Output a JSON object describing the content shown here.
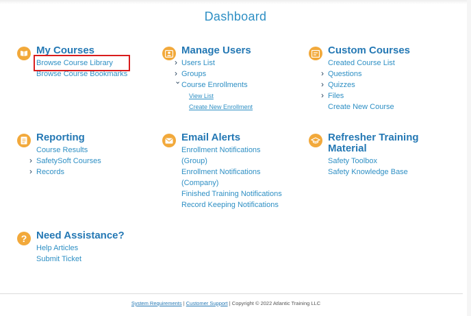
{
  "page": {
    "title": "Dashboard"
  },
  "sections": {
    "my_courses": {
      "title": "My Courses",
      "icon": "book-icon",
      "links": [
        "Browse Course Library",
        "Browse Course Bookmarks"
      ]
    },
    "manage_users": {
      "title": "Manage Users",
      "icon": "user-badge-icon",
      "links": [
        "Users List",
        "Groups",
        "Course Enrollments"
      ],
      "sub_links": [
        "View List",
        "Create New Enrollment"
      ]
    },
    "custom_courses": {
      "title": "Custom Courses",
      "icon": "edit-document-icon",
      "links": [
        "Created Course List",
        "Questions",
        "Quizzes",
        "Files",
        "Create New Course"
      ]
    },
    "reporting": {
      "title": "Reporting",
      "icon": "report-icon",
      "links": [
        "Course Results",
        "SafetySoft Courses",
        "Records"
      ]
    },
    "email_alerts": {
      "title": "Email Alerts",
      "icon": "envelope-icon",
      "links": [
        "Enrollment Notifications (Group)",
        "Enrollment Notifications (Company)",
        "Finished Training Notifications",
        "Record Keeping Notifications"
      ]
    },
    "refresher": {
      "title_line1": "Refresher Training",
      "title_line2": "Material",
      "icon": "graduation-cap-icon",
      "links": [
        "Safety Toolbox",
        "Safety Knowledge Base"
      ]
    },
    "assistance": {
      "title": "Need Assistance?",
      "icon": "question-icon",
      "links": [
        "Help Articles",
        "Submit Ticket"
      ]
    }
  },
  "footer": {
    "system_requirements": "System Requirements",
    "customer_support": "Customer Support",
    "separator": "|",
    "copyright": "Copyright © 2022 Atlantic Training LLC"
  },
  "colors": {
    "accent": "#2e8fc4",
    "title": "#2478b4",
    "icon_bg": "#f2a93b",
    "highlight": "#d81b1b"
  }
}
